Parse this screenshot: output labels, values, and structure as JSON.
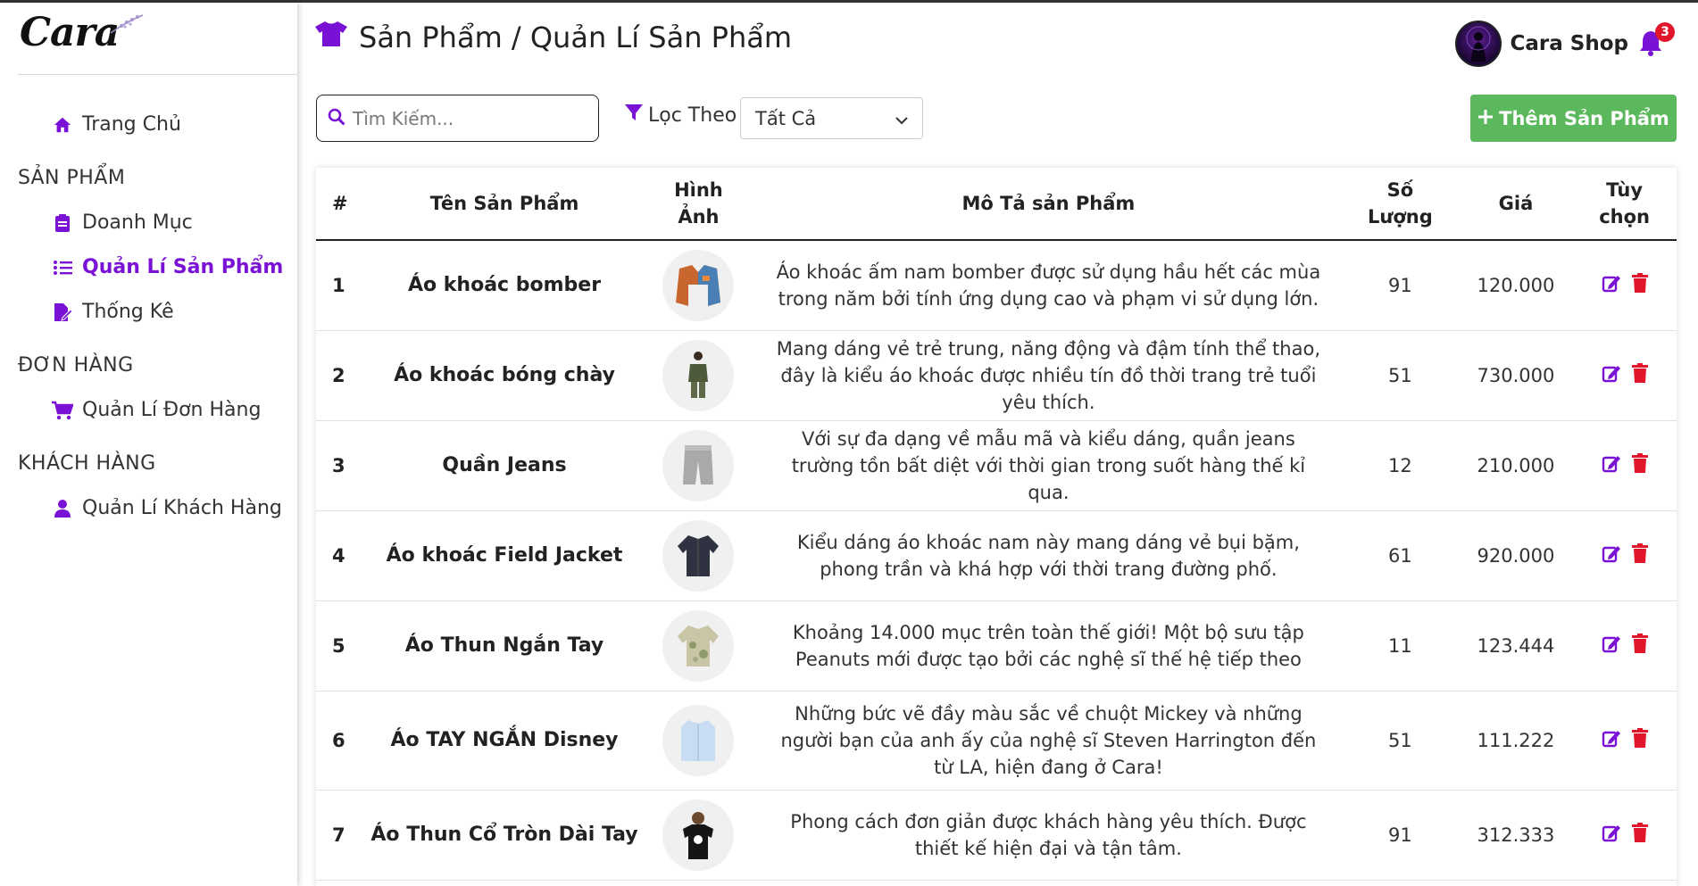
{
  "brand": {
    "logo_text": "Cara"
  },
  "sidebar": {
    "home": "Trang Chủ",
    "sections": [
      {
        "title": "SẢN PHẨM",
        "items": [
          "Doanh Mục",
          "Quản Lí Sản Phẩm",
          "Thống Kê"
        ]
      },
      {
        "title": "ĐƠN HÀNG",
        "items": [
          "Quản Lí Đơn Hàng"
        ]
      },
      {
        "title": "KHÁCH HÀNG",
        "items": [
          "Quản Lí Khách Hàng"
        ]
      }
    ],
    "active_item": "Quản Lí Sản Phẩm"
  },
  "header": {
    "title": "Sản Phẩm / Quản Lí Sản Phẩm",
    "shop_name": "Cara Shop",
    "notification_count": "3"
  },
  "toolbar": {
    "search_placeholder": "Tìm Kiếm...",
    "filter_label": "Lọc Theo",
    "filter_value": "Tất Cả",
    "add_button": "Thêm Sản Phẩm"
  },
  "table": {
    "headers": [
      "#",
      "Tên Sản Phẩm",
      "Hình Ảnh",
      "Mô Tả sản Phẩm",
      "Số Lượng",
      "Giá",
      "Tùy chọn"
    ],
    "rows": [
      {
        "id": "1",
        "name": "Áo khoác bomber",
        "image": "jacket-icon",
        "description": "Áo khoác ấm nam bomber được sử dụng hầu hết các mùa trong năm bởi tính ứng dụng cao và phạm vi sử dụng lớn.",
        "quantity": "91",
        "price": "120.000"
      },
      {
        "id": "2",
        "name": "Áo khoác bóng chày",
        "image": "person-icon",
        "description": "Mang dáng vẻ trẻ trung, năng động và đậm tính thể thao, đây là kiểu áo khoác được nhiều tín đồ thời trang trẻ tuổi yêu thích.",
        "quantity": "51",
        "price": "730.000"
      },
      {
        "id": "3",
        "name": "Quần Jeans",
        "image": "shorts-icon",
        "description": "Với sự đa dạng về mẫu mã và kiểu dáng, quần jeans trường tồn bất diệt với thời gian trong suốt hàng thế kỉ qua.",
        "quantity": "12",
        "price": "210.000"
      },
      {
        "id": "4",
        "name": "Áo khoác Field Jacket",
        "image": "shirt-dark-icon",
        "description": "Kiểu dáng áo khoác nam này mang dáng vẻ bụi bặm, phong trần và khá hợp với thời trang đường phố.",
        "quantity": "61",
        "price": "920.000"
      },
      {
        "id": "5",
        "name": "Áo Thun Ngắn Tay",
        "image": "shirt-floral-icon",
        "description": "Khoảng 14.000 mục trên toàn thế giới! Một bộ sưu tập Peanuts mới được tạo bởi các nghệ sĩ thế hệ tiếp theo",
        "quantity": "11",
        "price": "123.444"
      },
      {
        "id": "6",
        "name": "Áo TAY NGẮN Disney",
        "image": "shirt-light-icon",
        "description": "Những bức vẽ đầy màu sắc về chuột Mickey và những người bạn của anh ấy của nghệ sĩ Steven Harrington đến từ LA, hiện đang ở Cara!",
        "quantity": "51",
        "price": "111.222"
      },
      {
        "id": "7",
        "name": "Áo Thun Cổ Tròn Dài Tay",
        "image": "tshirt-person-icon",
        "description": "Phong cách đơn giản được khách hàng yêu thích. Được thiết kế hiện đại và tận tâm.",
        "quantity": "91",
        "price": "312.333"
      }
    ]
  },
  "colors": {
    "accent": "#7a12d6",
    "add_button": "#5cb85c",
    "delete": "#e2162b",
    "badge": "#e2162b"
  }
}
